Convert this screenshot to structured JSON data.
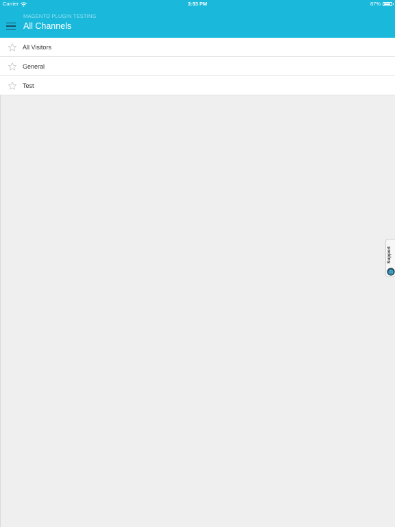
{
  "status_bar": {
    "carrier": "Carrier",
    "time": "3:53 PM",
    "battery": "87%",
    "battery_level": 0.87
  },
  "header": {
    "subtitle": "MAGENTO PLUGIN TESTING",
    "title": "All Channels",
    "background_color": "#1ab9dc"
  },
  "channels": [
    {
      "label": "All Visitors",
      "starred": false
    },
    {
      "label": "General",
      "starred": false
    },
    {
      "label": "Test",
      "starred": false
    }
  ],
  "support_tab": {
    "label": "Support"
  },
  "icons": {
    "menu": "hamburger-menu-icon",
    "star": "star-outline-icon",
    "wifi": "wifi-icon",
    "battery": "battery-icon",
    "support_avatar": "support-agent-icon"
  }
}
